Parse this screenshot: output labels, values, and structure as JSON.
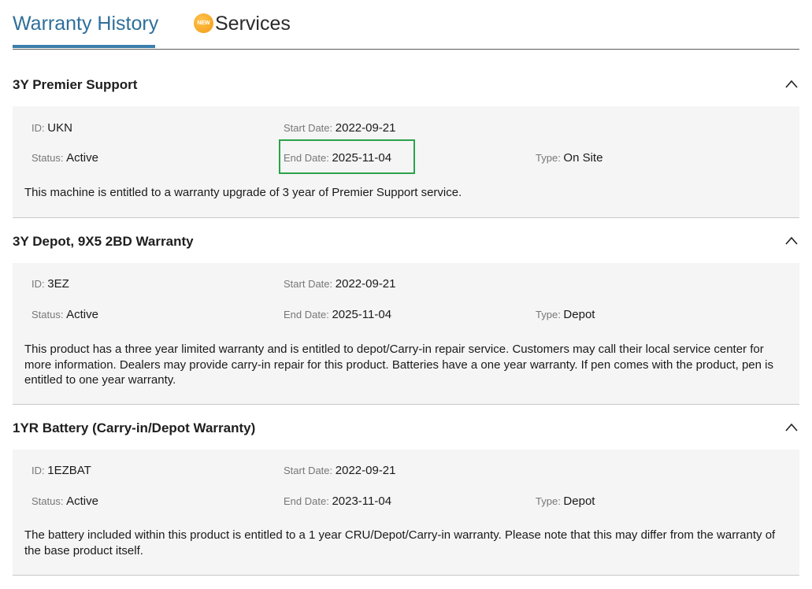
{
  "tabs": {
    "warranty_history": "Warranty History",
    "services": "Services",
    "new_badge": "NEW"
  },
  "labels": {
    "id": "ID",
    "status": "Status",
    "start_date": "Start Date",
    "end_date": "End Date",
    "type": "Type",
    "sep": ": "
  },
  "warranties": [
    {
      "title": "3Y Premier Support",
      "id": "UKN",
      "status": "Active",
      "start_date": "2022-09-21",
      "end_date": "2025-11-04",
      "type": "On Site",
      "description": "This machine is entitled to a warranty upgrade of 3 year of Premier Support service."
    },
    {
      "title": "3Y Depot, 9X5 2BD Warranty",
      "id": "3EZ",
      "status": "Active",
      "start_date": "2022-09-21",
      "end_date": "2025-11-04",
      "type": "Depot",
      "description": "This product has a three year limited warranty and is entitled to depot/Carry-in repair service. Customers may call their local service center for more information. Dealers may provide carry-in repair for this product. Batteries have a one year warranty. If pen comes with the product, pen is entitled to one year warranty."
    },
    {
      "title": "1YR Battery (Carry-in/Depot Warranty)",
      "id": "1EZBAT",
      "status": "Active",
      "start_date": "2022-09-21",
      "end_date": "2023-11-04",
      "type": "Depot",
      "description": "The battery included within this product is entitled to a 1 year CRU/Depot/Carry-in warranty. Please note that this may differ from the warranty of the base product itself."
    }
  ],
  "colors": {
    "accent": "#2f6f9a",
    "highlight": "#2aa34a",
    "panel_bg": "#f5f5f5"
  }
}
